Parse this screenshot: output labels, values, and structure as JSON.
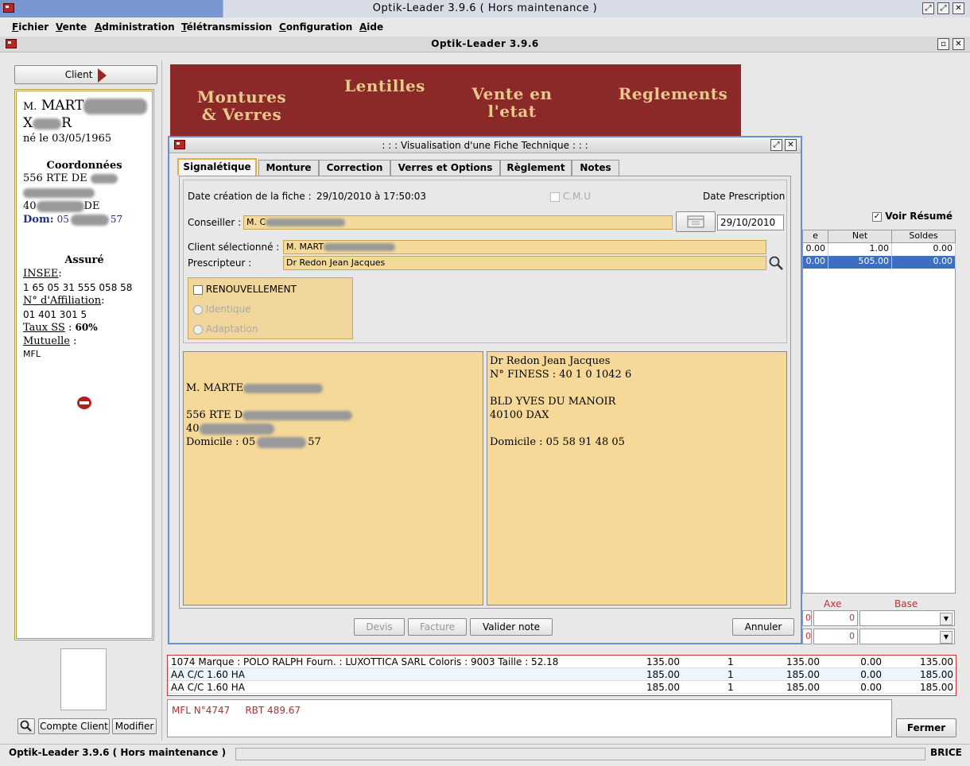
{
  "window": {
    "title": "Optik-Leader 3.9.6 ( Hors maintenance )"
  },
  "menu": [
    "Fichier",
    "Vente",
    "Administration",
    "Télétransmission",
    "Configuration",
    "Aide"
  ],
  "inner_window": {
    "title": "Optik-Leader 3.9.6"
  },
  "left": {
    "client_button": "Client",
    "name_prefix": "M.",
    "name": "MART",
    "firstname": "X",
    "firstname_end": "R",
    "birth": "né le 03/05/1965",
    "coord_heading": "Coordonnées",
    "addr1": "556 RTE DE",
    "addr3_start": "40",
    "addr3_end": "DE",
    "dom_label": "Dom:",
    "dom_start": "05",
    "dom_end": "57",
    "assure_heading": "Assuré",
    "insee_label": "INSEE",
    "insee_value": "1 65 05 31 555 058 58",
    "affiliation_label": "N° d'Affiliation",
    "affiliation_value": "01 401 301 5",
    "taux_label": "Taux SS",
    "taux_value": "60%",
    "mutuelle_label": "Mutuelle",
    "mutuelle_value": "MFL",
    "compte_button": "Compte Client",
    "modifier_button": "Modifier"
  },
  "banner": {
    "montures": "Montures\n& Verres",
    "lentilles": "Lentilles",
    "vente": "Vente en\nl'etat",
    "reglements": "Reglements"
  },
  "dialog": {
    "title": ": : : Visualisation d'une Fiche Technique : : :",
    "tabs": [
      "Signalétique",
      "Monture",
      "Correction",
      "Verres et Options",
      "Règlement",
      "Notes"
    ],
    "creation_label": "Date création de la fiche  :",
    "creation_value": "29/10/2010 à 17:50:03",
    "cmu_label": "C.M.U",
    "prescription_label": "Date Prescription",
    "conseiller_label": "Conseiller :",
    "conseiller_value": "M. C",
    "prescription_date": "29/10/2010",
    "client_label": "Client sélectionné  :",
    "client_value": "M. MART",
    "prescripteur_label": "Prescripteur :",
    "prescripteur_value": "Dr Redon Jean Jacques",
    "renouvellement": "RENOUVELLEMENT",
    "identique": "Identique",
    "adaptation": "Adaptation",
    "client_addr": {
      "name": "M. MARTE",
      "addr1": "556 RTE D",
      "addr2": "40",
      "dom_label": "Domicile : 05",
      "dom_end": "57"
    },
    "presc_addr": {
      "name": "Dr Redon Jean Jacques",
      "finess": "N° FINESS : 40 1 0 1042 6",
      "addr1": "BLD YVES DU MANOIR",
      "addr2": "40100 DAX",
      "dom": "Domicile : 05 58 91 48 05"
    },
    "btn_devis": "Devis",
    "btn_facture": "Facture",
    "btn_valider": "Valider note",
    "btn_annuler": "Annuler"
  },
  "right": {
    "voir_resume": "Voir Résumé",
    "col_e": "e",
    "col_net": "Net",
    "col_soldes": "Soldes",
    "row1": [
      "0.00",
      "1.00",
      "0.00"
    ],
    "row2": [
      "0.00",
      "505.00",
      "0.00"
    ],
    "axe": "Axe",
    "base": "Base",
    "axe_value1": "0",
    "axe_value2": "0",
    "axe_prefix1": "0",
    "axe_prefix2": "0"
  },
  "lines": [
    [
      "1074   Marque : POLO RALPH    Fourn. : LUXOTTICA SARL    Coloris : 9003    Taille : 52.18",
      "135.00",
      "1",
      "135.00",
      "0.00",
      "135.00"
    ],
    [
      "AA C/C 1.60 HA",
      "185.00",
      "1",
      "185.00",
      "0.00",
      "185.00"
    ],
    [
      "AA C/C 1.60 HA",
      "185.00",
      "1",
      "185.00",
      "0.00",
      "185.00"
    ]
  ],
  "note": "MFL N°4747     RBT 489.67",
  "fermer": "Fermer",
  "status": {
    "left": "Optik-Leader 3.9.6 ( Hors maintenance )",
    "right": "BRICE"
  },
  "colors": {
    "accent_title": "#7a96d0",
    "banner": "#8b2828",
    "banner_text": "#e7c98c",
    "field": "#f3d99a",
    "selected_row": "#3b6fc4"
  },
  "icons": [
    "app-icon",
    "minimize-icon",
    "maximize-icon",
    "close-icon",
    "arrow-right-icon",
    "search-icon",
    "calendar-icon",
    "check-icon"
  ]
}
